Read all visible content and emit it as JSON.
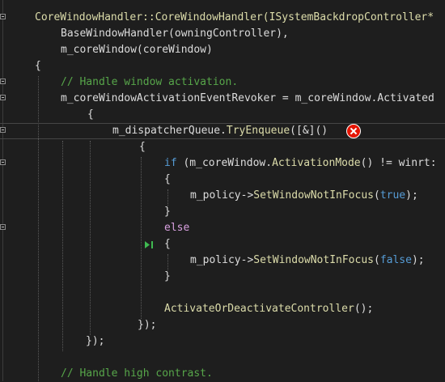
{
  "editor": {
    "lines": [
      {
        "fold": true,
        "current": false,
        "tokens": [
          {
            "t": "CoreWindowHandler::CoreWindowHandler(ISystemBackdropController*",
            "c": "fn"
          }
        ]
      },
      {
        "fold": false,
        "current": false,
        "tokens": [
          {
            "t": "BaseWindowHandler(owningController),",
            "c": "var"
          }
        ]
      },
      {
        "fold": false,
        "current": false,
        "tokens": [
          {
            "t": "m_coreWindow(coreWindow)",
            "c": "var"
          }
        ]
      },
      {
        "fold": false,
        "current": false,
        "tokens": [
          {
            "t": "{",
            "c": "var"
          }
        ]
      },
      {
        "fold": true,
        "current": false,
        "tokens": [
          {
            "t": "// Handle window activation.",
            "c": "cm"
          }
        ]
      },
      {
        "fold": true,
        "current": false,
        "tokens": [
          {
            "t": "m_coreWindowActivationEventRevoker = m_coreWindow.Activated",
            "c": "var"
          }
        ]
      },
      {
        "fold": false,
        "current": false,
        "tokens": [
          {
            "t": "{",
            "c": "var"
          }
        ]
      },
      {
        "fold": true,
        "current": true,
        "tokens": [
          {
            "t": "m_dispatcherQueue.",
            "c": "var"
          },
          {
            "t": "TryEnqueue",
            "c": "fn"
          },
          {
            "t": "([&]()",
            "c": "var"
          }
        ]
      },
      {
        "fold": false,
        "current": false,
        "tokens": [
          {
            "t": "{",
            "c": "var"
          }
        ]
      },
      {
        "fold": true,
        "current": false,
        "tokens": [
          {
            "t": "if",
            "c": "kw"
          },
          {
            "t": " (m_coreWindow.",
            "c": "var"
          },
          {
            "t": "ActivationMode",
            "c": "fn"
          },
          {
            "t": "() != winrt:",
            "c": "var"
          }
        ]
      },
      {
        "fold": false,
        "current": false,
        "tokens": [
          {
            "t": "{",
            "c": "var"
          }
        ]
      },
      {
        "fold": false,
        "current": false,
        "tokens": [
          {
            "t": "m_policy->",
            "c": "var"
          },
          {
            "t": "SetWindowNotInFocus",
            "c": "fn"
          },
          {
            "t": "(",
            "c": "var"
          },
          {
            "t": "true",
            "c": "kw"
          },
          {
            "t": ");",
            "c": "var"
          }
        ]
      },
      {
        "fold": false,
        "current": false,
        "tokens": [
          {
            "t": "}",
            "c": "var"
          }
        ]
      },
      {
        "fold": true,
        "current": false,
        "tokens": [
          {
            "t": "else",
            "c": "ctl"
          }
        ]
      },
      {
        "fold": false,
        "current": false,
        "tokens": [
          {
            "t": "{",
            "c": "var"
          }
        ]
      },
      {
        "fold": false,
        "current": false,
        "tokens": [
          {
            "t": "m_policy->",
            "c": "var"
          },
          {
            "t": "SetWindowNotInFocus",
            "c": "fn"
          },
          {
            "t": "(",
            "c": "var"
          },
          {
            "t": "false",
            "c": "kw"
          },
          {
            "t": ");",
            "c": "var"
          }
        ]
      },
      {
        "fold": false,
        "current": false,
        "tokens": [
          {
            "t": "}",
            "c": "var"
          }
        ]
      },
      {
        "fold": false,
        "current": false,
        "tokens": []
      },
      {
        "fold": false,
        "current": false,
        "tokens": [
          {
            "t": "ActivateOrDeactivateController",
            "c": "fn"
          },
          {
            "t": "();",
            "c": "var"
          }
        ]
      },
      {
        "fold": false,
        "current": false,
        "tokens": [
          {
            "t": "});",
            "c": "var"
          }
        ]
      },
      {
        "fold": false,
        "current": false,
        "tokens": [
          {
            "t": "});",
            "c": "var"
          }
        ]
      },
      {
        "fold": false,
        "current": false,
        "tokens": []
      },
      {
        "fold": false,
        "current": false,
        "tokens": [
          {
            "t": "// Handle high contrast.",
            "c": "cm"
          }
        ]
      }
    ],
    "error_icon": "error-circle-icon",
    "run_icon": "run-to-cursor-icon",
    "colors": {
      "background": "#1e1e1e",
      "default_text": "#dcdcdc",
      "function": "#dcdcaa",
      "comment": "#57a64a",
      "keyword": "#569cd6",
      "control_keyword": "#d8a0df",
      "error": "#e51400",
      "run_arrow": "#3fb950"
    }
  }
}
